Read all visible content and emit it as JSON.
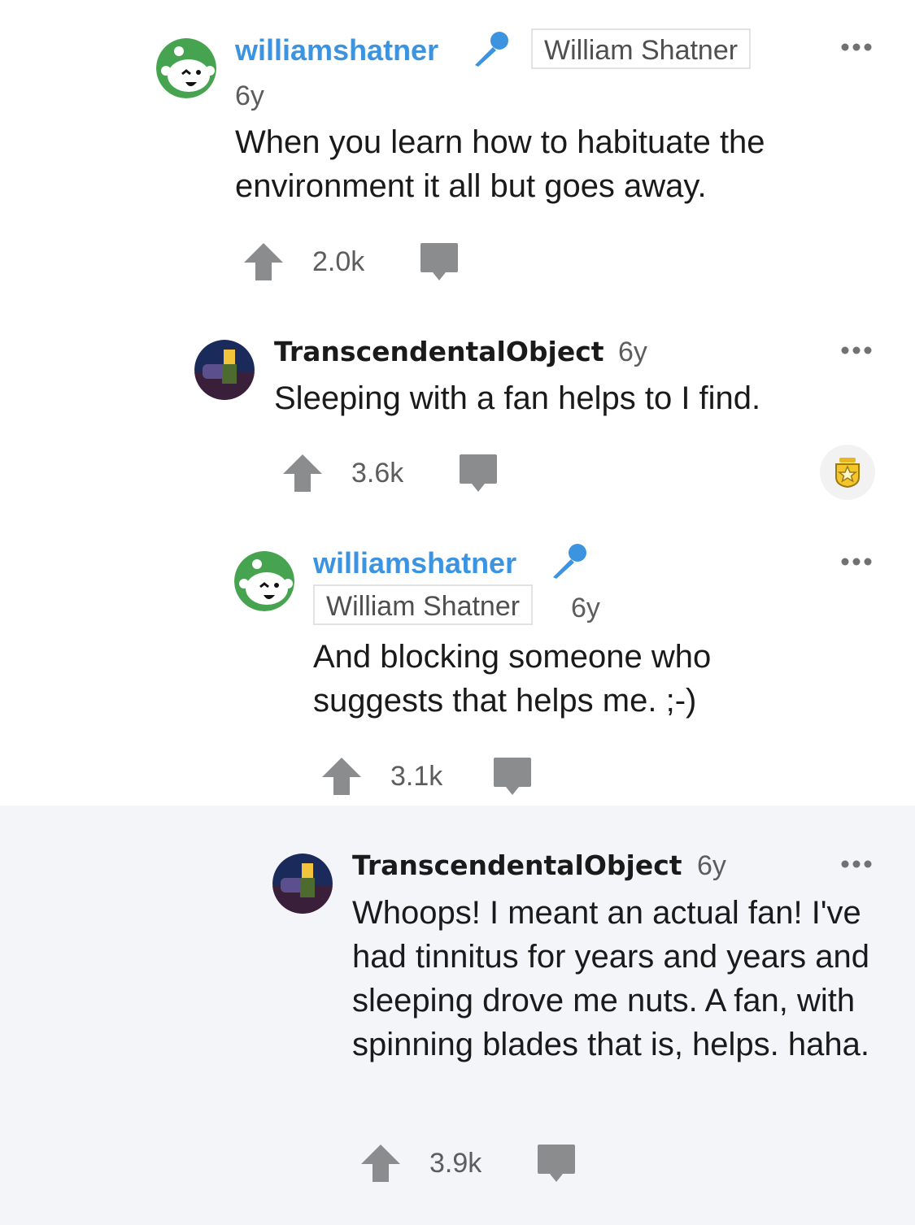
{
  "colors": {
    "username_op": "#3c94e0",
    "highlight_bg": "#f3f5f9",
    "icon_gray": "#8a8c8e",
    "award_gold": "#e8b723"
  },
  "comments": [
    {
      "username": "williamshatner",
      "mic_icon": "microphone-icon",
      "flair": "William Shatner",
      "age": "6y",
      "text": "When you learn how to habituate the environment it all but goes away.",
      "score": "2.0k"
    },
    {
      "username": "TranscendentalObject",
      "age": "6y",
      "text": "Sleeping with a fan helps to I find.",
      "score": "3.6k",
      "award_icon": "award-badge-icon"
    },
    {
      "username": "williamshatner",
      "mic_icon": "microphone-icon",
      "flair": "William Shatner",
      "age": "6y",
      "text": "And blocking someone who suggests that helps me. ;-)",
      "score": "3.1k"
    },
    {
      "username": "TranscendentalObject",
      "age": "6y",
      "text": "Whoops! I meant an actual fan! I've had tinnitus for years and years and sleeping drove me nuts. A fan, with spinning blades that is, helps. haha.",
      "score": "3.9k"
    }
  ]
}
